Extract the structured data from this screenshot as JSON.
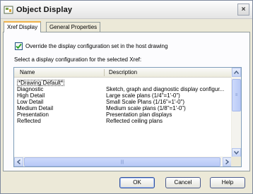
{
  "window": {
    "title": "Object Display",
    "close_glyph": "×"
  },
  "tabs": [
    {
      "label": "Xref Display",
      "active": true
    },
    {
      "label": "General Properties",
      "active": false
    }
  ],
  "override": {
    "checked": true,
    "label": "Override the display configuration set in the host drawing"
  },
  "instruction": "Select a display configuration for the selected Xref:",
  "list": {
    "columns": [
      "Name",
      "Description"
    ],
    "rows": [
      {
        "name": "*Drawing Default*",
        "description": ""
      },
      {
        "name": "Diagnostic",
        "description": "Sketch, graph and diagnostic display configur..."
      },
      {
        "name": "High Detail",
        "description": "Large scale plans (1/4\"=1'-0\")"
      },
      {
        "name": "Low Detail",
        "description": "Small Scale Plans (1/16\"=1'-0\")"
      },
      {
        "name": "Medium Detail",
        "description": "Medium scale plans (1/8\"=1'-0\")"
      },
      {
        "name": "Presentation",
        "description": "Presentation plan displays"
      },
      {
        "name": "Reflected",
        "description": "Reflected ceiling plans"
      }
    ],
    "selected_index": 0
  },
  "buttons": {
    "ok": "OK",
    "cancel": "Cancel",
    "help": "Help"
  },
  "icons": {
    "app": "object-display-icon",
    "check": "checkmark-icon"
  },
  "colors": {
    "accent_tab": "#f0b24b",
    "check": "#21a121",
    "scroll": "#c5d3f5"
  }
}
